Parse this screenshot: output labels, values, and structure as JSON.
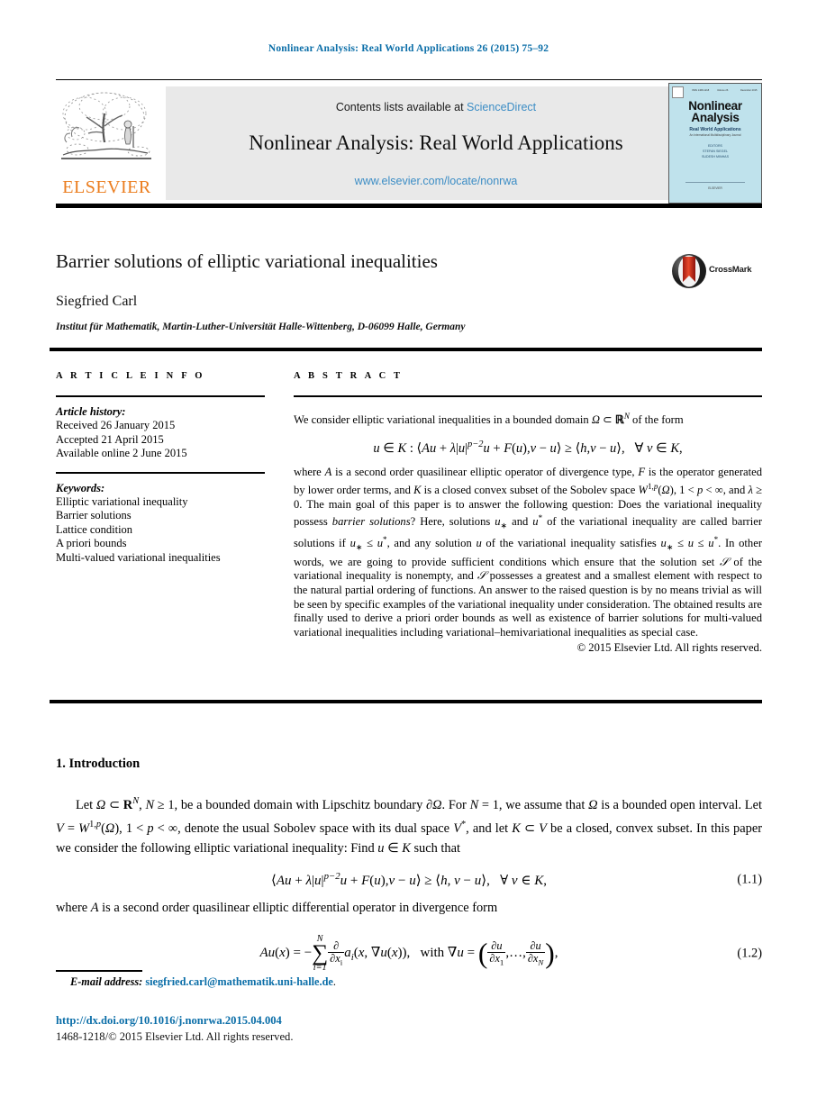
{
  "running_head": "Nonlinear Analysis: Real World Applications 26 (2015) 75–92",
  "masthead": {
    "contents_line": "Contents lists available at ",
    "sciencedirect": "ScienceDirect",
    "journal_title": "Nonlinear Analysis: Real World Applications",
    "journal_url": "www.elsevier.com/locate/nonrwa",
    "publisher": "ELSEVIER",
    "cover": {
      "title_line1": "Nonlinear",
      "title_line2": "Analysis",
      "subtitle": "Real World Applications",
      "subtitle2": "An International Multidisciplinary Journal",
      "editors": "EDITORS\nSTEFAN SIEGEL\nSUDESH MINHAS",
      "footer": "ELSEVIER"
    }
  },
  "article": {
    "title": "Barrier solutions of elliptic variational inequalities",
    "crossmark_label": "CrossMark",
    "author": "Siegfried Carl",
    "affiliation": "Institut für Mathematik, Martin-Luther-Universität Halle-Wittenberg, D-06099 Halle, Germany"
  },
  "info": {
    "heading": "A R T I C L E   I N F O",
    "history_label": "Article history:",
    "history": [
      "Received 26 January 2015",
      "Accepted 21 April 2015",
      "Available online 2 June 2015"
    ],
    "keywords_label": "Keywords:",
    "keywords": [
      "Elliptic variational inequality",
      "Barrier solutions",
      "Lattice condition",
      "A priori bounds",
      "Multi-valued variational inequalities"
    ]
  },
  "abstract": {
    "heading": "A B S T R A C T",
    "lead": "We consider elliptic variational inequalities in a bounded domain Ω ⊂ ℝ",
    "lead_sup": "N",
    "lead_tail": " of the form",
    "body": "where A is a second order quasilinear elliptic operator of divergence type, F is the operator generated by lower order terms, and K is a closed convex subset of the Sobolev space W1,p(Ω), 1 < p < ∞, and λ ≥ 0. The main goal of this paper is to answer the following question: Does the variational inequality possess barrier solutions? Here, solutions u∗ and u* of the variational inequality are called barrier solutions if u∗ ≤ u*, and any solution u of the variational inequality satisfies u∗ ≤ u ≤ u*. In other words, we are going to provide sufficient conditions which ensure that the solution set S of the variational inequality is nonempty, and S possesses a greatest and a smallest element with respect to the natural partial ordering of functions. An answer to the raised question is by no means trivial as will be seen by specific examples of the variational inequality under consideration. The obtained results are finally used to derive a priori order bounds as well as existence of barrier solutions for multi-valued variational inequalities including variational–hemivariational inequalities as special case.",
    "copyright": "© 2015 Elsevier Ltd. All rights reserved."
  },
  "introduction": {
    "heading": "1.  Introduction",
    "para1": "Let Ω ⊂ ℝN, N ≥ 1, be a bounded domain with Lipschitz boundary ∂Ω. For N = 1, we assume that Ω is a bounded open interval. Let V = W1,p(Ω), 1 < p < ∞, denote the usual Sobolev space with its dual space V*, and let K ⊂ V be a closed, convex subset. In this paper we consider the following elliptic variational inequality: Find u ∈ K such that",
    "eq1_number": "(1.1)",
    "para2": "where A is a second order quasilinear elliptic differential operator in divergence form",
    "eq2_number": "(1.2)"
  },
  "footer": {
    "email_label": "E-mail address:",
    "email": "siegfried.carl@mathematik.uni-halle.de",
    "email_period": ".",
    "doi": "http://dx.doi.org/10.1016/j.nonrwa.2015.04.004",
    "issn_line": "1468-1218/© 2015 Elsevier Ltd. All rights reserved."
  },
  "colors": {
    "link_blue": "#0b6ea8",
    "sciencedirect_blue": "#3c8dc5",
    "elsevier_orange": "#eb7d1e",
    "cover_bg": "#bfe2ec",
    "band_gray": "#e9e9e9"
  }
}
